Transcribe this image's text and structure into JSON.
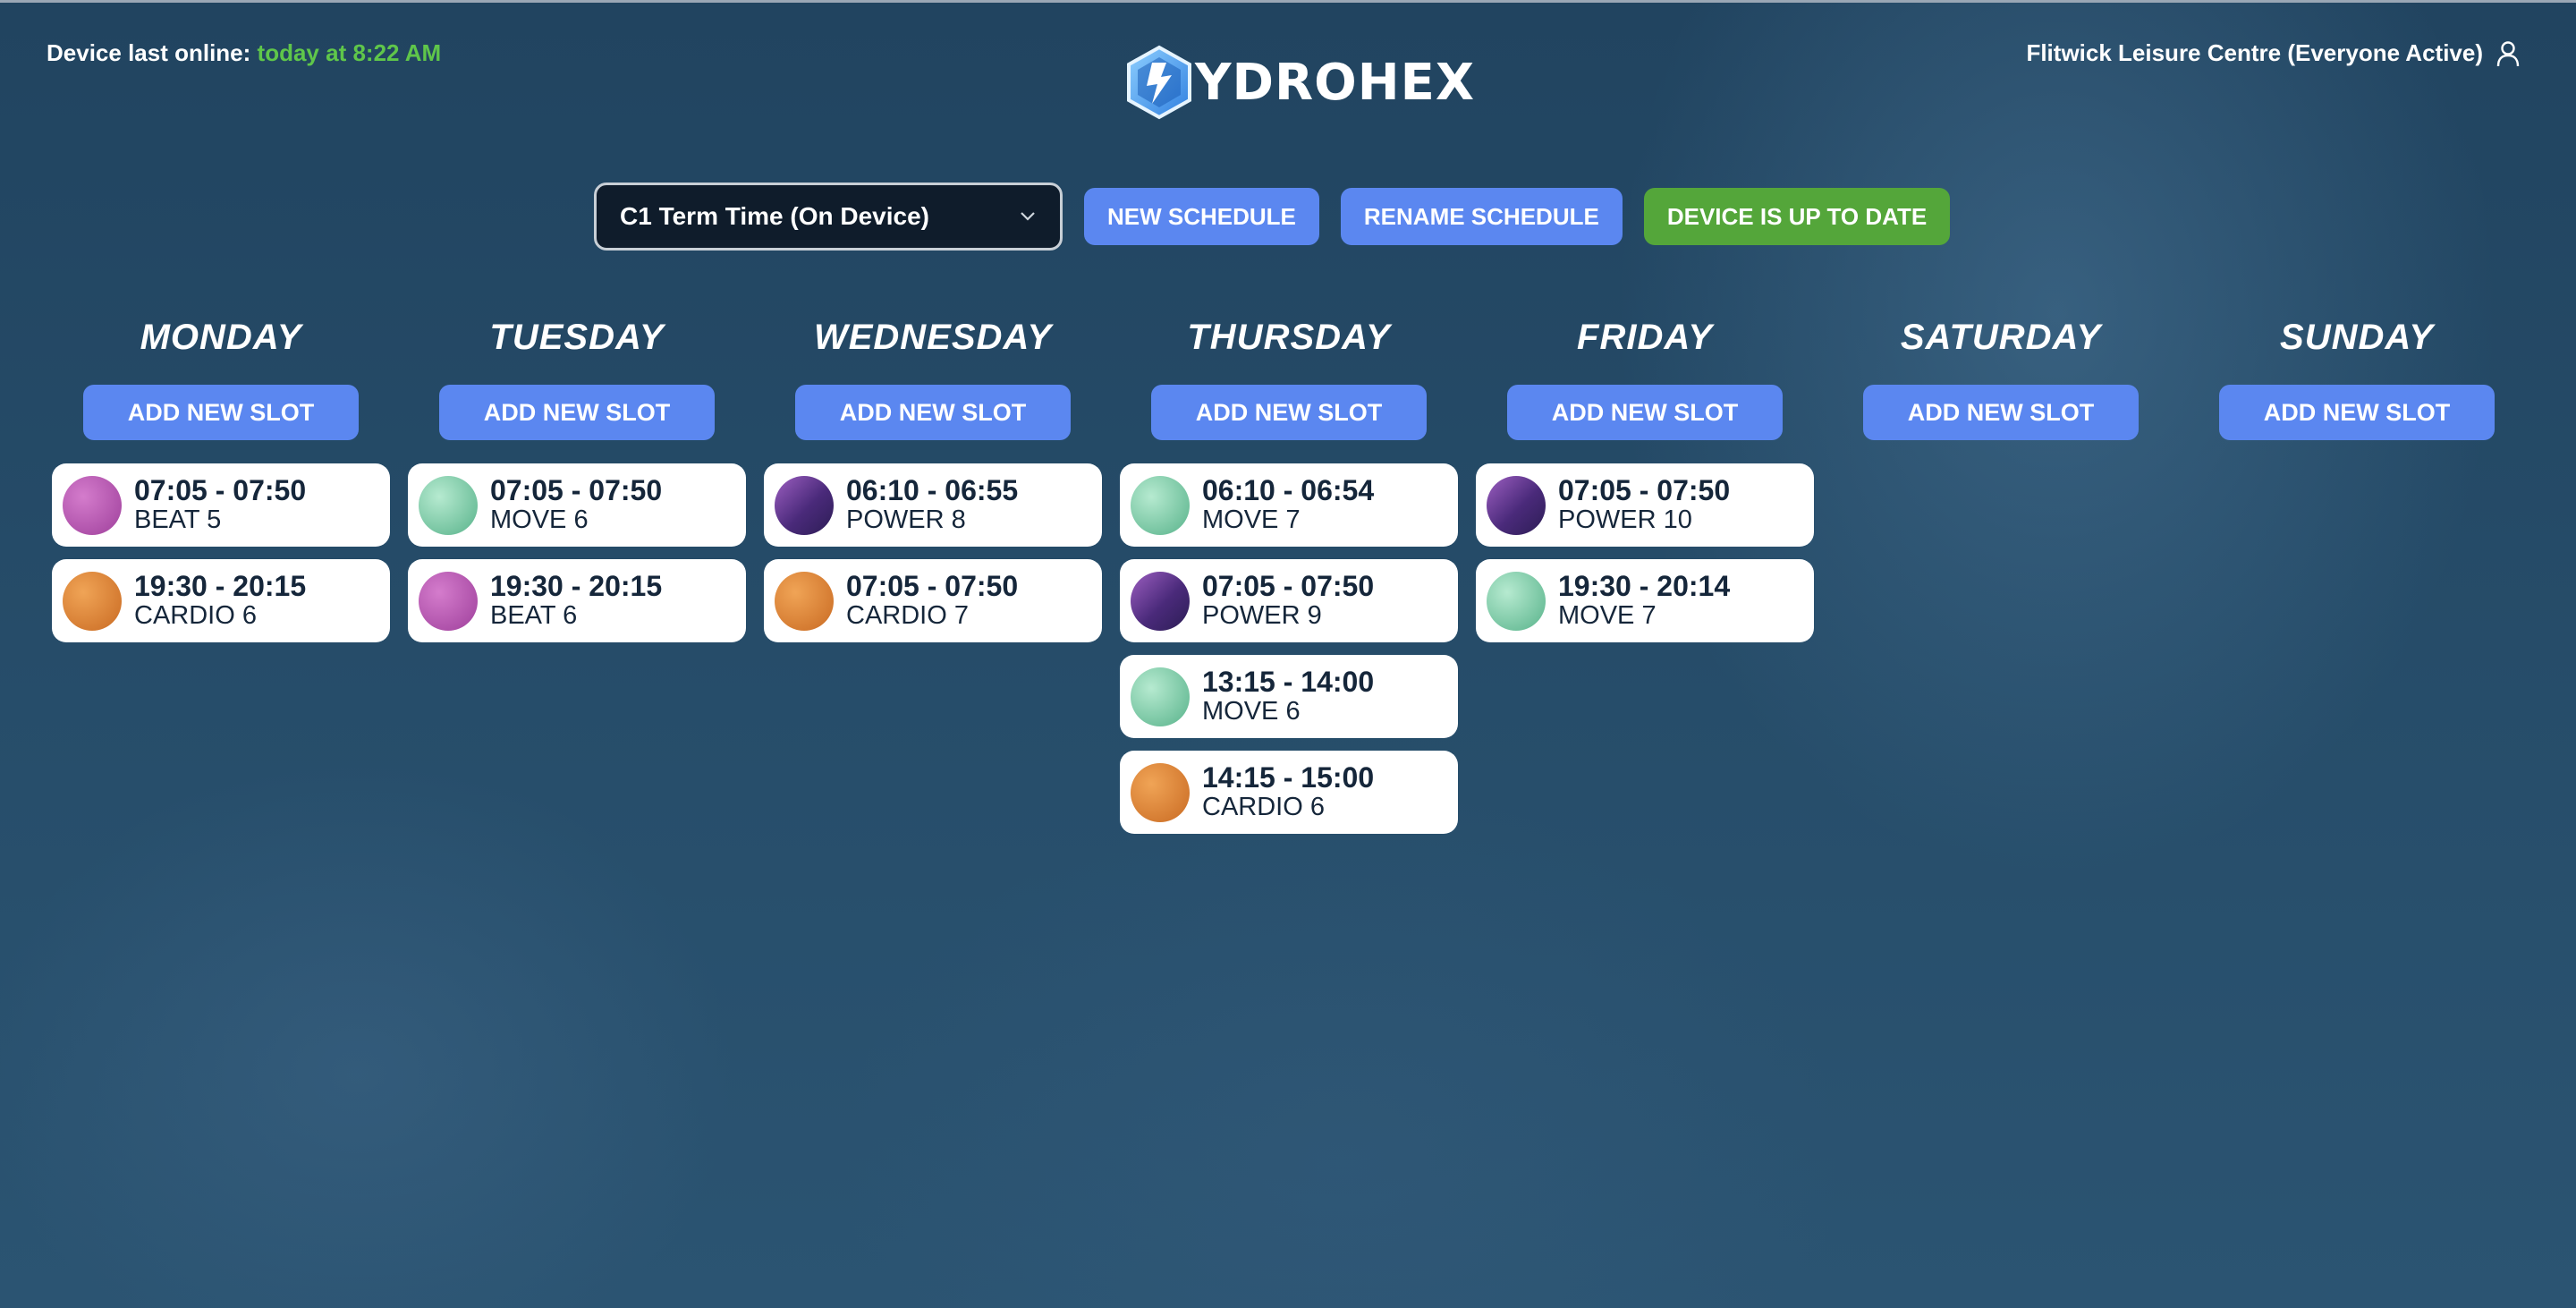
{
  "status": {
    "last_online_label": "Device last online:",
    "last_online_value": "today at 8:22 AM"
  },
  "brand": {
    "logo_text": "YDROHEX"
  },
  "venue": {
    "name": "Flitwick Leisure Centre (Everyone Active)"
  },
  "toolbar": {
    "schedule_select": "C1 Term Time (On Device)",
    "new_schedule": "NEW SCHEDULE",
    "rename_schedule": "RENAME SCHEDULE",
    "device_status": "DEVICE IS UP TO DATE"
  },
  "colors": {
    "accent_blue": "#5b87f0",
    "status_green": "#54a63a",
    "online_green": "#5fc64a"
  },
  "add_slot_label": "ADD NEW SLOT",
  "days": [
    {
      "name": "MONDAY",
      "slots": [
        {
          "time": "07:05 - 07:50",
          "name": "BEAT 5",
          "kind": "beat"
        },
        {
          "time": "19:30 - 20:15",
          "name": "CARDIO 6",
          "kind": "cardio"
        }
      ]
    },
    {
      "name": "TUESDAY",
      "slots": [
        {
          "time": "07:05 - 07:50",
          "name": "MOVE 6",
          "kind": "move"
        },
        {
          "time": "19:30 - 20:15",
          "name": "BEAT 6",
          "kind": "beat"
        }
      ]
    },
    {
      "name": "WEDNESDAY",
      "slots": [
        {
          "time": "06:10 - 06:55",
          "name": "POWER 8",
          "kind": "power"
        },
        {
          "time": "07:05 - 07:50",
          "name": "CARDIO 7",
          "kind": "cardio"
        }
      ]
    },
    {
      "name": "THURSDAY",
      "slots": [
        {
          "time": "06:10 - 06:54",
          "name": "MOVE 7",
          "kind": "move"
        },
        {
          "time": "07:05 - 07:50",
          "name": "POWER 9",
          "kind": "power"
        },
        {
          "time": "13:15 - 14:00",
          "name": "MOVE 6",
          "kind": "move"
        },
        {
          "time": "14:15 - 15:00",
          "name": "CARDIO 6",
          "kind": "cardio"
        }
      ]
    },
    {
      "name": "FRIDAY",
      "slots": [
        {
          "time": "07:05 - 07:50",
          "name": "POWER 10",
          "kind": "power"
        },
        {
          "time": "19:30 - 20:14",
          "name": "MOVE 7",
          "kind": "move"
        }
      ]
    },
    {
      "name": "SATURDAY",
      "slots": []
    },
    {
      "name": "SUNDAY",
      "slots": []
    }
  ]
}
